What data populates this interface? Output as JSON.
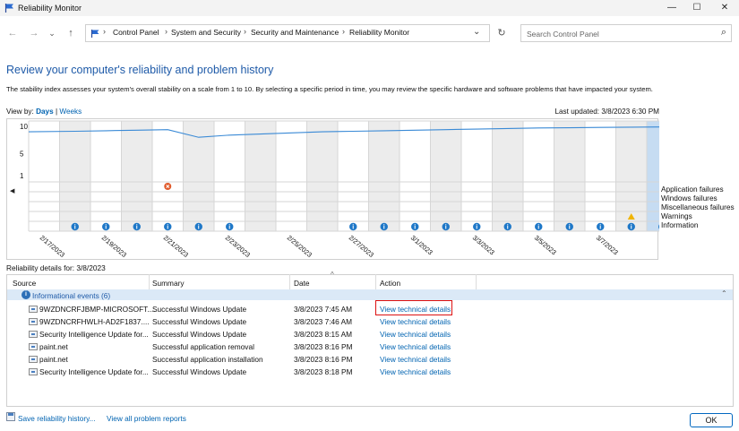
{
  "window": {
    "title": "Reliability Monitor",
    "controls": {
      "minimize": "—",
      "maximize": "☐",
      "close": "✕"
    }
  },
  "nav": {
    "back_icon": "←",
    "forward_icon": "→",
    "history_icon": "⌄",
    "up_icon": "↑",
    "breadcrumb": [
      "Control Panel",
      "System and Security",
      "Security and Maintenance",
      "Reliability Monitor"
    ],
    "dropdown_icon": "⌄",
    "refresh_icon": "↻",
    "search_placeholder": "Search Control Panel",
    "search_icon": "⌕"
  },
  "page": {
    "heading": "Review your computer's reliability and problem history",
    "description": "The stability index assesses your system's overall stability on a scale from 1 to 10. By selecting a specific period in time, you may review the specific hardware and software problems that have impacted your system.",
    "view_by_label": "View by:",
    "view_days": "Days",
    "view_sep": "|",
    "view_weeks": "Weeks",
    "last_updated": "Last updated: 3/8/2023 6:30 PM"
  },
  "chart_data": {
    "type": "line",
    "y_ticks": [
      "10",
      "5",
      "1"
    ],
    "ylim": [
      1,
      10
    ],
    "columns": 21,
    "selected_column": 20,
    "stability_index": [
      9.0,
      9.1,
      9.2,
      9.3,
      9.4,
      8.0,
      8.4,
      8.6,
      8.8,
      9.0,
      9.1,
      9.2,
      9.3,
      9.4,
      9.5,
      9.6,
      9.7,
      9.75,
      9.8,
      9.85,
      9.9
    ],
    "date_labels": [
      "2/17/2023",
      "2/19/2023",
      "2/21/2023",
      "2/23/2023",
      "2/25/2023",
      "2/27/2023",
      "3/1/2023",
      "3/3/2023",
      "3/5/2023",
      "3/7/2023"
    ],
    "legend": [
      "Application failures",
      "Windows failures",
      "Miscellaneous failures",
      "Warnings",
      "Information"
    ],
    "application_failure_columns": [
      4
    ],
    "warning_columns": [
      19
    ],
    "information_columns": [
      1,
      2,
      3,
      4,
      5,
      6,
      10,
      11,
      12,
      13,
      14,
      15,
      16,
      17,
      18,
      19,
      20
    ],
    "scroll_left": "◀",
    "scroll_right": "▶"
  },
  "details": {
    "label": "Reliability details for: 3/8/2023",
    "columns": [
      "Source",
      "Summary",
      "Date",
      "Action"
    ],
    "sort_indicator": "^",
    "group": {
      "label": "Informational events (6)",
      "icon": "info-icon",
      "chevron": "⌃"
    },
    "rows": [
      {
        "source": "9WZDNCRFJBMP-MICROSOFT....",
        "summary": "Successful Windows Update",
        "date": "3/8/2023 7:45 AM",
        "action": "View technical details"
      },
      {
        "source": "9WZDNCRFHWLH-AD2F1837....",
        "summary": "Successful Windows Update",
        "date": "3/8/2023 7:46 AM",
        "action": "View technical details"
      },
      {
        "source": "Security Intelligence Update for...",
        "summary": "Successful Windows Update",
        "date": "3/8/2023 8:15 AM",
        "action": "View technical details"
      },
      {
        "source": "paint.net",
        "summary": "Successful application removal",
        "date": "3/8/2023 8:16 PM",
        "action": "View technical details"
      },
      {
        "source": "paint.net",
        "summary": "Successful application installation",
        "date": "3/8/2023 8:16 PM",
        "action": "View technical details"
      },
      {
        "source": "Security Intelligence Update for...",
        "summary": "Successful Windows Update",
        "date": "3/8/2023 8:18 PM",
        "action": "View technical details"
      }
    ]
  },
  "footer": {
    "save_link": "Save reliability history...",
    "view_all_link": "View all problem reports",
    "ok_button": "OK"
  },
  "colors": {
    "accent": "#0063b1",
    "heading": "#1e5aa8",
    "line": "#3a8ad6",
    "selected_column": "#c6dcf2",
    "error": "#e05a2b",
    "warning": "#f0b400",
    "info": "#1f78c8",
    "highlight_border": "#dd1111"
  }
}
